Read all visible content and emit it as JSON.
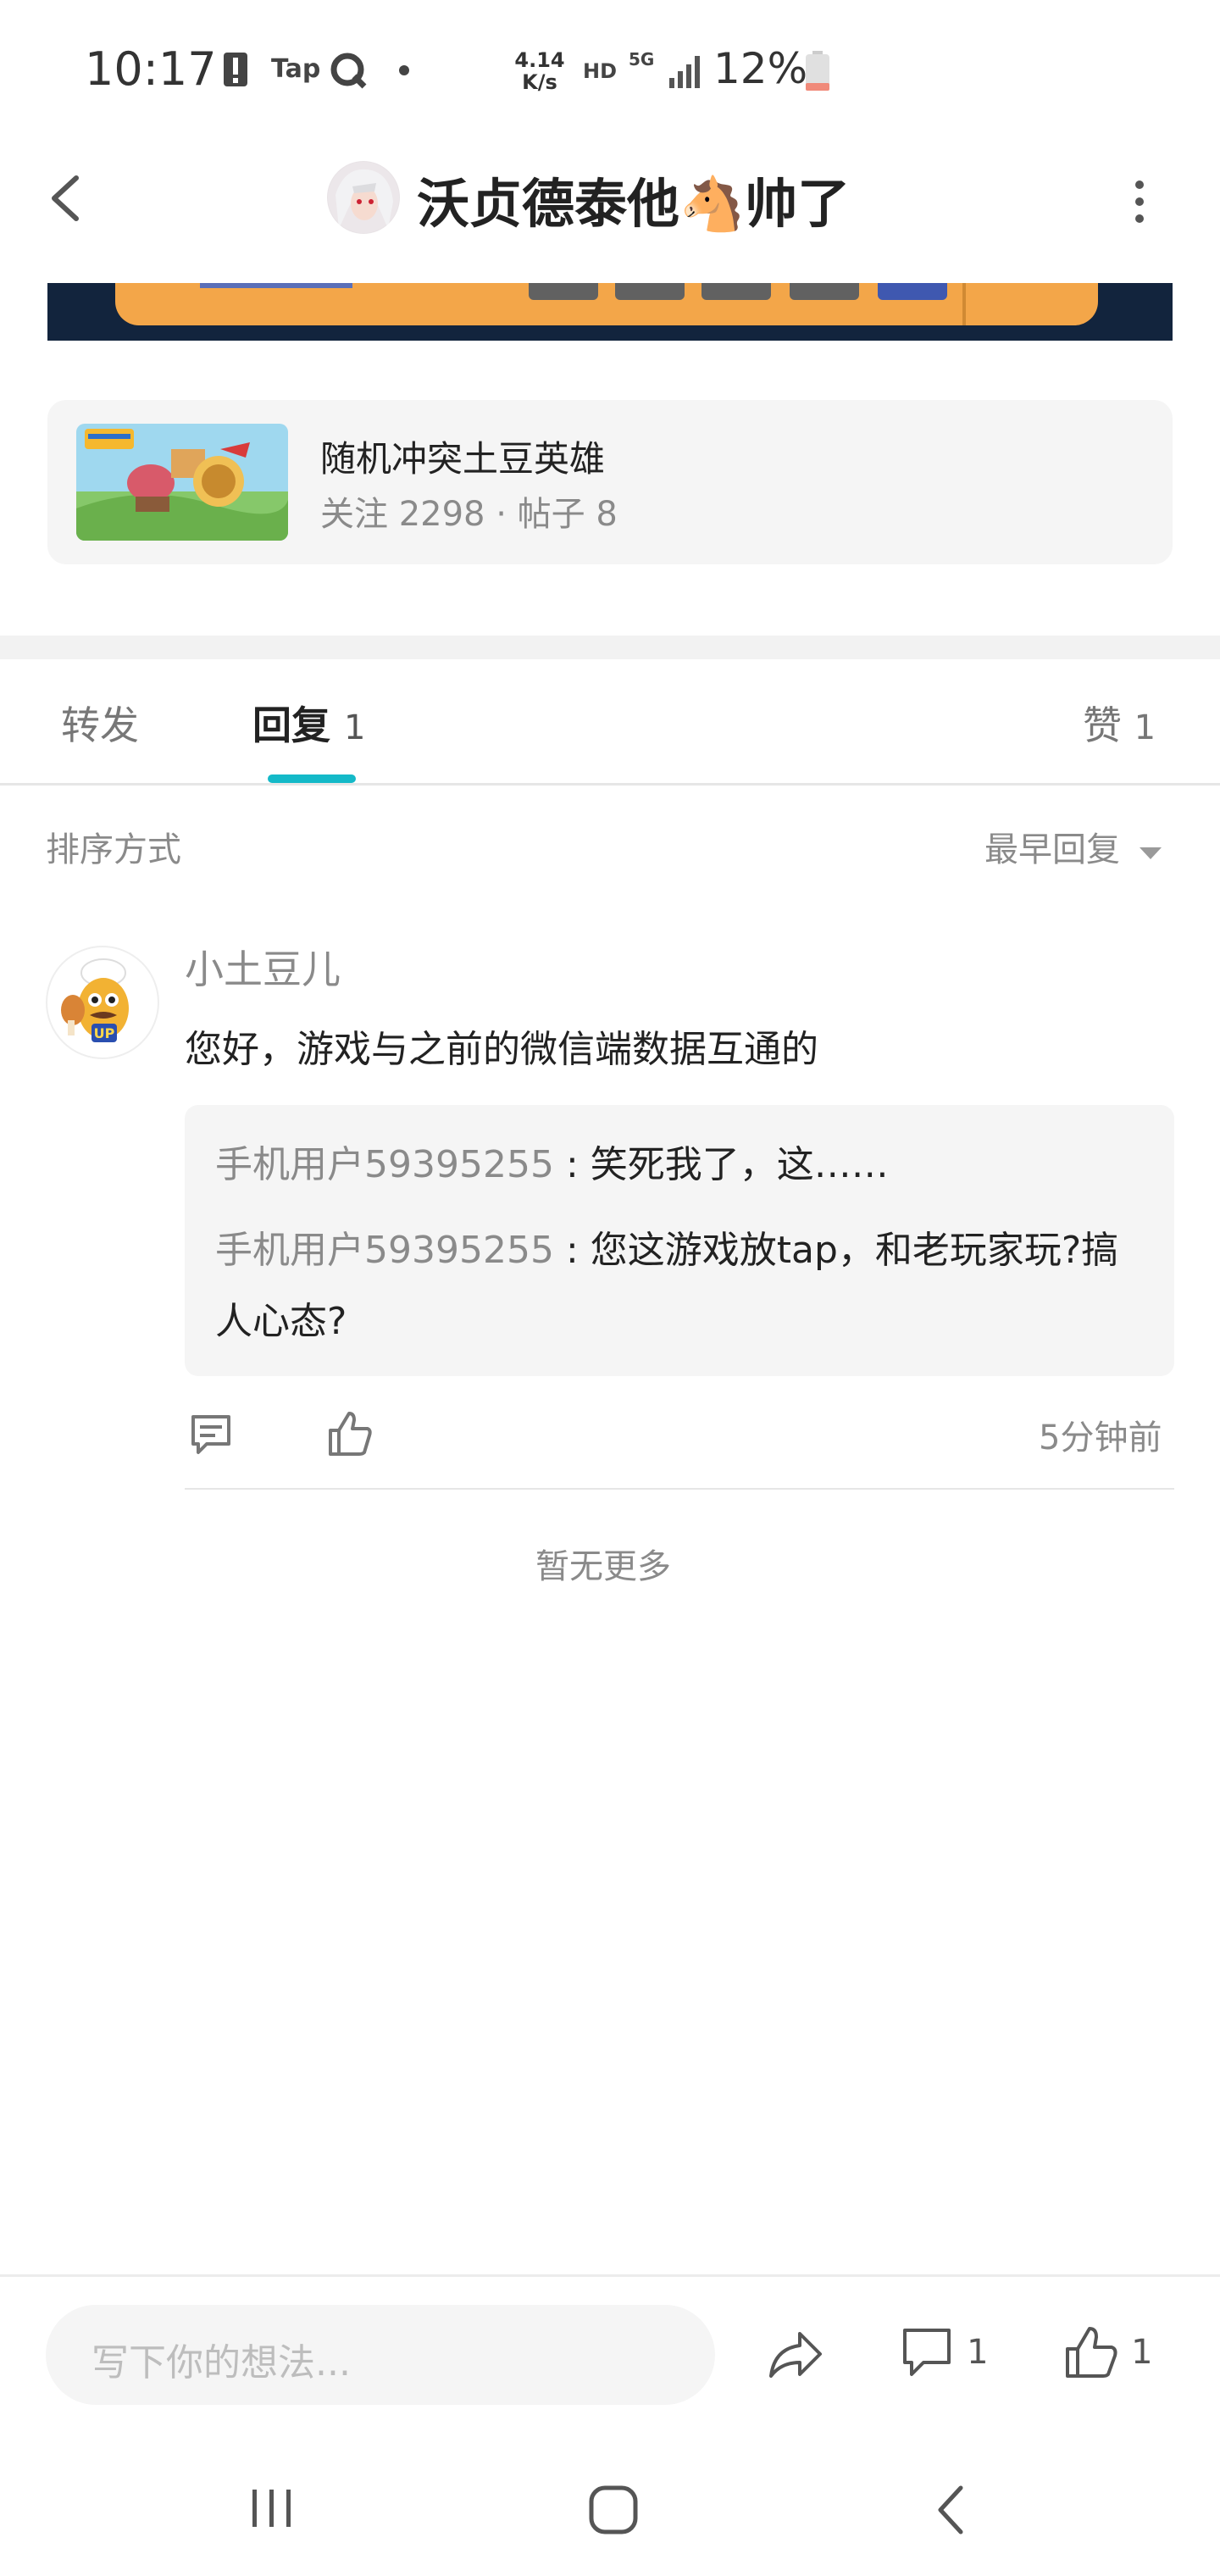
{
  "status_bar": {
    "time": "10:17",
    "tap_label": "Tap",
    "speed_value": "4.14",
    "speed_unit": "K/s",
    "hd_label": "HD",
    "network": "5G",
    "battery": "12%"
  },
  "header": {
    "title": "沃贞德泰他🐴帅了"
  },
  "game_card": {
    "name": "随机冲突土豆英雄",
    "stats": "关注 2298 · 帖子 8"
  },
  "tabs": [
    {
      "label": "转发",
      "count": ""
    },
    {
      "label": "回复",
      "count": "1"
    },
    {
      "label": "赞",
      "count": "1"
    }
  ],
  "sort": {
    "label": "排序方式",
    "value": "最早回复"
  },
  "comment": {
    "author": "小土豆儿",
    "avatar_badge": "UP",
    "text": "您好，游戏与之前的微信端数据互通的",
    "replies": [
      {
        "user": "手机用户59395255",
        "text": " : 笑死我了，这……"
      },
      {
        "user": "手机用户59395255",
        "text": " : 您这游戏放tap，和老玩家玩?搞人心态?"
      }
    ],
    "time": "5分钟前"
  },
  "no_more": "暂无更多",
  "bottom_bar": {
    "placeholder": "写下你的想法...",
    "comment_count": "1",
    "like_count": "1"
  },
  "colors": {
    "accent": "#14b9c8",
    "muted_text": "#8a8a8a",
    "battery_low": "#f08a7a"
  }
}
